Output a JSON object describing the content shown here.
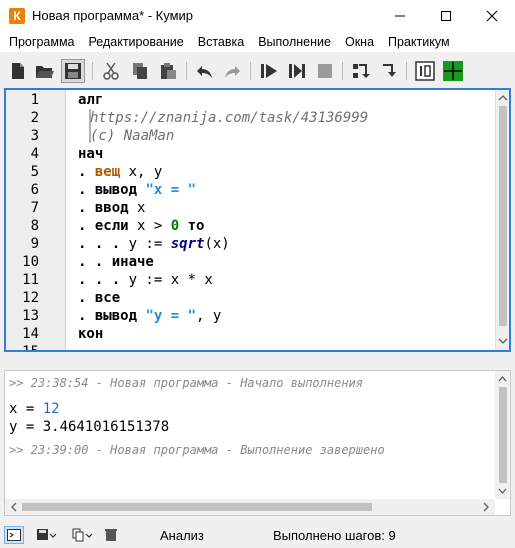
{
  "window": {
    "title": "Новая программа* - Кумир",
    "app_icon_letter": "К"
  },
  "menu": [
    "Программа",
    "Редактирование",
    "Вставка",
    "Выполнение",
    "Окна",
    "Практикум"
  ],
  "toolbar": [
    "new-file-icon",
    "open-folder-icon",
    "save-icon",
    "cut-icon",
    "copy-icon",
    "paste-icon",
    "undo-icon",
    "redo-icon",
    "run-icon",
    "run-step-icon",
    "stop-icon",
    "step-into-icon",
    "step-out-icon",
    "robot-panel-icon",
    "drawer-panel-icon"
  ],
  "editor": {
    "line_numbers": [
      "1",
      "2",
      "3",
      "4",
      "5",
      "6",
      "7",
      "8",
      "9",
      "10",
      "11",
      "12",
      "13",
      "14",
      "15"
    ],
    "lines": [
      [
        {
          "t": "алг",
          "c": "kw"
        }
      ],
      [
        {
          "t": "https://znanija.com/task/43136999",
          "c": "comment"
        }
      ],
      [
        {
          "t": "(c) NaaMan",
          "c": "comment"
        }
      ],
      [
        {
          "t": "нач",
          "c": "kw"
        }
      ],
      [
        {
          "t": ". ",
          "c": "kw"
        },
        {
          "t": "вещ",
          "c": "kw-type"
        },
        {
          "t": " x, y",
          "c": ""
        }
      ],
      [
        {
          "t": ". ",
          "c": "kw"
        },
        {
          "t": "вывод",
          "c": "kw"
        },
        {
          "t": " ",
          "c": ""
        },
        {
          "t": "\"x = \"",
          "c": "str"
        }
      ],
      [
        {
          "t": ". ",
          "c": "kw"
        },
        {
          "t": "ввод",
          "c": "kw"
        },
        {
          "t": " x",
          "c": ""
        }
      ],
      [
        {
          "t": ". ",
          "c": "kw"
        },
        {
          "t": "если",
          "c": "kw"
        },
        {
          "t": " x > ",
          "c": ""
        },
        {
          "t": "0",
          "c": "num"
        },
        {
          "t": " ",
          "c": ""
        },
        {
          "t": "то",
          "c": "kw"
        }
      ],
      [
        {
          "t": ". . . ",
          "c": "kw"
        },
        {
          "t": "y := ",
          "c": ""
        },
        {
          "t": "sqrt",
          "c": "fn"
        },
        {
          "t": "(x)",
          "c": ""
        }
      ],
      [
        {
          "t": ". . ",
          "c": "kw"
        },
        {
          "t": "иначе",
          "c": "kw"
        }
      ],
      [
        {
          "t": ". . . ",
          "c": "kw"
        },
        {
          "t": "y := x * x",
          "c": ""
        }
      ],
      [
        {
          "t": ". ",
          "c": "kw"
        },
        {
          "t": "все",
          "c": "kw"
        }
      ],
      [
        {
          "t": ". ",
          "c": "kw"
        },
        {
          "t": "вывод",
          "c": "kw"
        },
        {
          "t": " ",
          "c": ""
        },
        {
          "t": "\"y = \"",
          "c": "str"
        },
        {
          "t": ", y",
          "c": ""
        }
      ],
      [
        {
          "t": "кон",
          "c": "kw"
        }
      ],
      []
    ]
  },
  "console": {
    "log_start": ">> 23:38:54 - Новая программа - Начало выполнения",
    "out1_label": "x = ",
    "out1_value": "12",
    "out2": "y = 3.4641016151378",
    "log_end": ">> 23:39:00 - Новая программа - Выполнение завершено"
  },
  "status": {
    "icons": [
      "console-icon",
      "save-console-icon",
      "copy-console-icon",
      "clear-console-icon"
    ],
    "mode": "Анализ",
    "steps": "Выполнено шагов: 9"
  }
}
